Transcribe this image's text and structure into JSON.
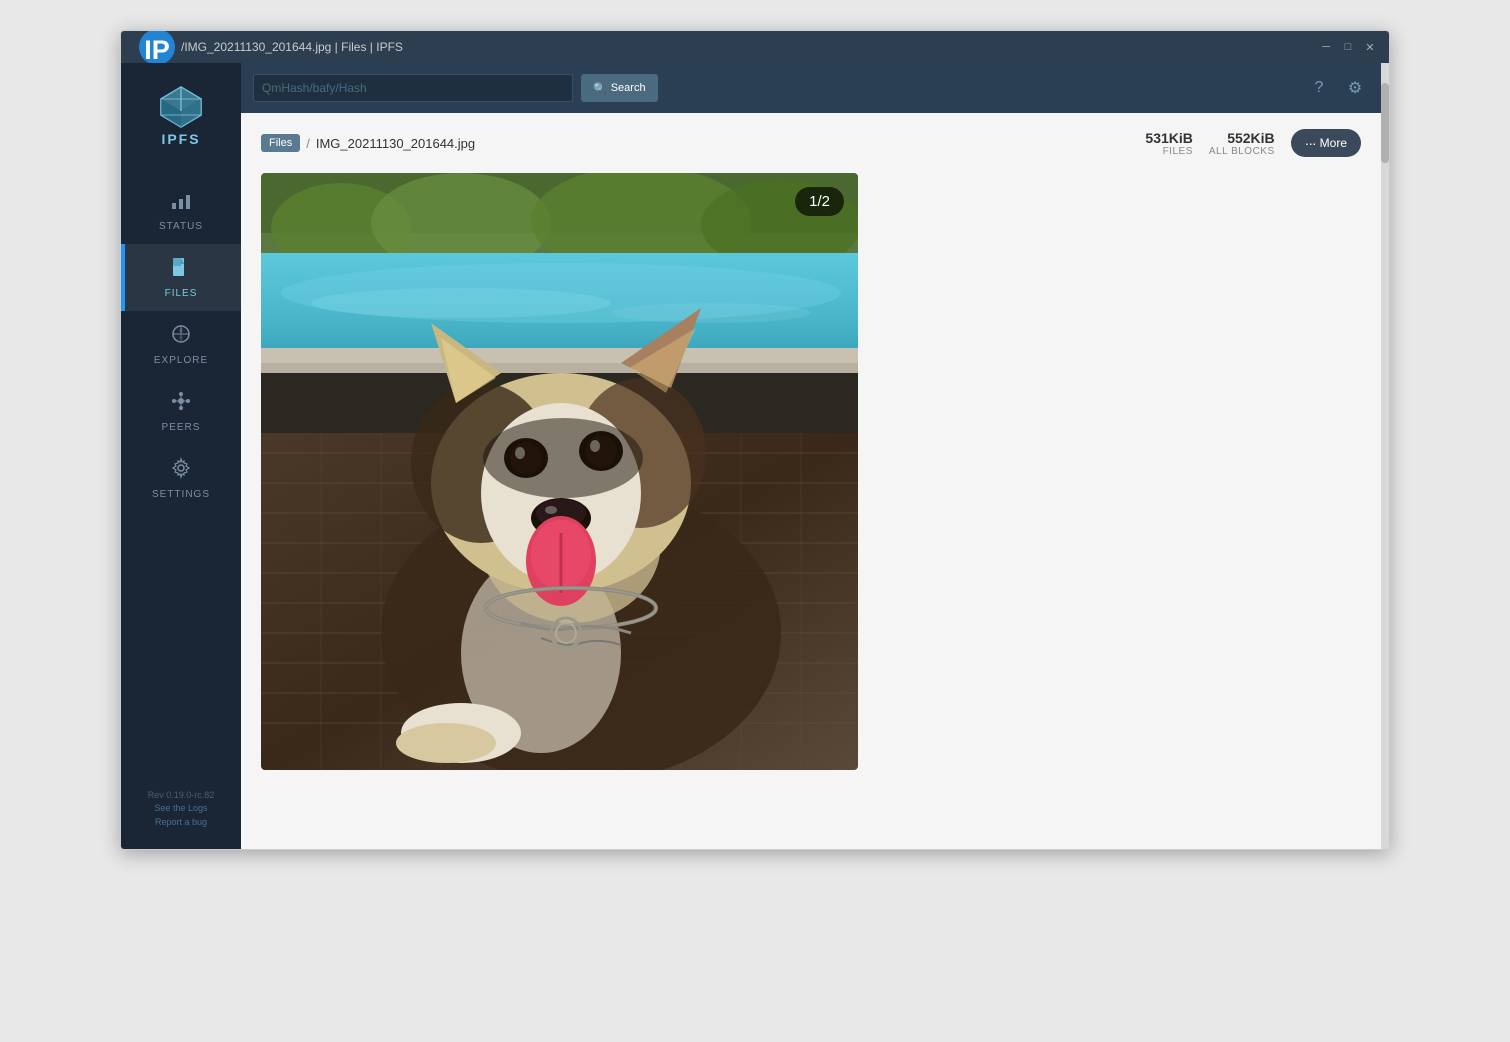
{
  "window": {
    "title": "/IMG_20211130_201644.jpg | Files | IPFS",
    "icon": "ipfs-icon"
  },
  "sidebar": {
    "logo_label": "IPFS",
    "nav_items": [
      {
        "id": "status",
        "label": "STATUS",
        "icon": "chart-icon",
        "active": false
      },
      {
        "id": "files",
        "label": "FILES",
        "icon": "file-icon",
        "active": true
      },
      {
        "id": "explore",
        "label": "EXPLORE",
        "icon": "explore-icon",
        "active": false
      },
      {
        "id": "peers",
        "label": "PEERS",
        "icon": "peers-icon",
        "active": false
      },
      {
        "id": "settings",
        "label": "SETTINGS",
        "icon": "settings-icon",
        "active": false
      }
    ],
    "footer": {
      "version": "Rev 0.19.0-rc.82",
      "links": "See the Logs",
      "report": "Report a bug"
    }
  },
  "topbar": {
    "search_placeholder": "QmHash/bafy/Hash",
    "search_button": "Search",
    "help_icon": "?",
    "settings_icon": "⚙"
  },
  "breadcrumb": {
    "files_label": "Files",
    "separator": "/",
    "current_file": "IMG_20211130_201644.jpg"
  },
  "file_stats": {
    "files_size": "531KiB",
    "files_label": "FILES",
    "blocks_size": "552KiB",
    "blocks_label": "ALL BLOCKS",
    "more_label": "More",
    "more_dots": "···"
  },
  "image_viewer": {
    "counter": "1/2"
  }
}
